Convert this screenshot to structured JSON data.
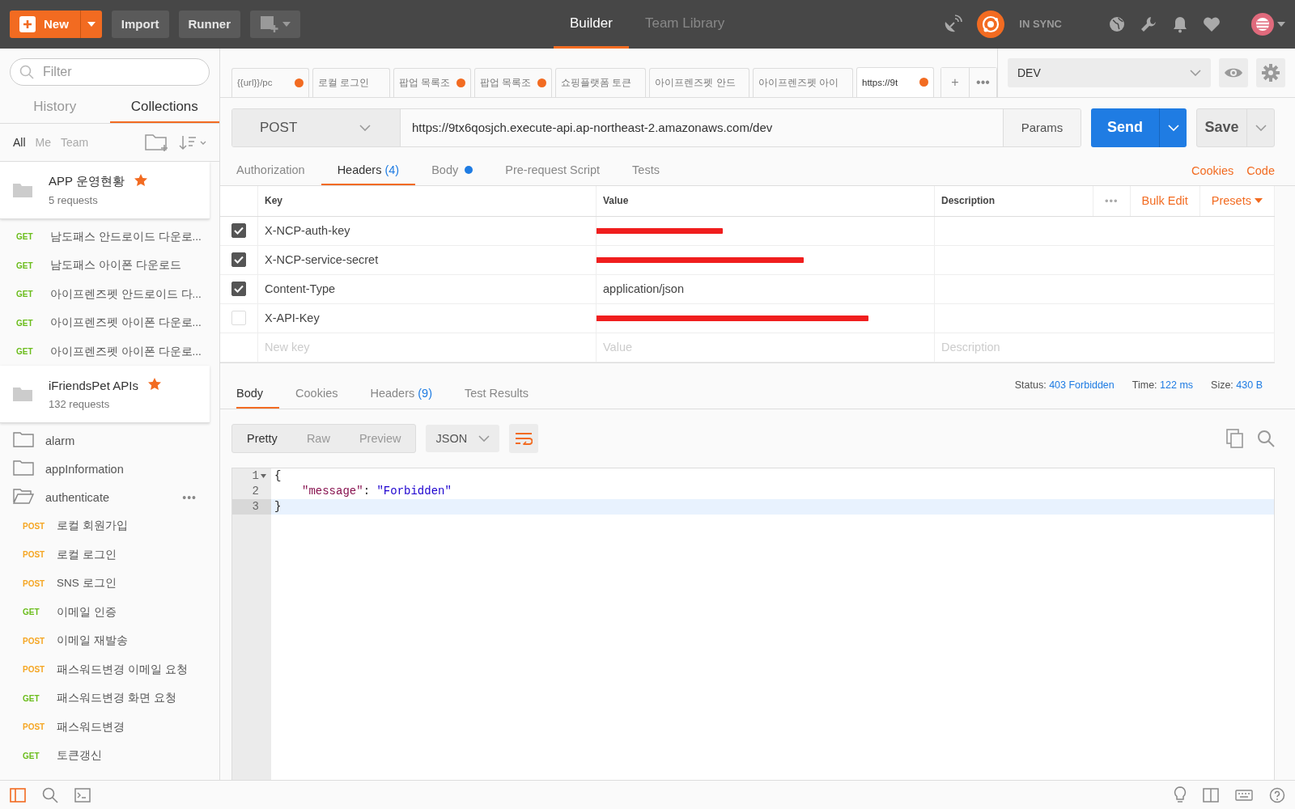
{
  "top_bar": {
    "new_button": "New",
    "buttons": [
      "Import",
      "Runner"
    ],
    "nav_tabs": [
      {
        "label": "Builder",
        "selected": true
      },
      {
        "label": "Team Library",
        "selected": false
      }
    ],
    "sync_status": "IN SYNC"
  },
  "sidebar": {
    "filter_placeholder": "Filter",
    "tabs": [
      {
        "label": "History",
        "selected": false
      },
      {
        "label": "Collections",
        "selected": true
      }
    ],
    "scopes": [
      {
        "label": "All",
        "selected": true
      },
      {
        "label": "Me",
        "selected": false
      },
      {
        "label": "Team",
        "selected": false
      }
    ],
    "items": [
      {
        "kind": "collection",
        "name": "APP 운영현황",
        "count": "5 requests",
        "starred": true
      },
      {
        "kind": "request",
        "method": "GET",
        "name": "남도패스 안드로이드 다운로..."
      },
      {
        "kind": "request",
        "method": "GET",
        "name": "남도패스 아이폰 다운로드"
      },
      {
        "kind": "request",
        "method": "GET",
        "name": "아이프렌즈펫 안드로이드 다..."
      },
      {
        "kind": "request",
        "method": "GET",
        "name": "아이프렌즈펫 아이폰 다운로..."
      },
      {
        "kind": "request",
        "method": "GET",
        "name": "아이프렌즈펫 아이폰 다운로..."
      },
      {
        "kind": "collection",
        "name": "iFriendsPet APIs",
        "count": "132 requests",
        "starred": true
      },
      {
        "kind": "folder",
        "name": "alarm",
        "expanded": false
      },
      {
        "kind": "folder",
        "name": "appInformation",
        "expanded": false
      },
      {
        "kind": "folder",
        "name": "authenticate",
        "expanded": true,
        "more": "•••"
      },
      {
        "kind": "request",
        "method": "POST",
        "name": "로컬 회원가입"
      },
      {
        "kind": "request",
        "method": "POST",
        "name": "로컬 로그인"
      },
      {
        "kind": "request",
        "method": "POST",
        "name": "SNS 로그인"
      },
      {
        "kind": "request",
        "method": "GET",
        "name": "이메일 인증"
      },
      {
        "kind": "request",
        "method": "POST",
        "name": "이메일 재발송"
      },
      {
        "kind": "request",
        "method": "POST",
        "name": "패스워드변경 이메일 요청"
      },
      {
        "kind": "request",
        "method": "GET",
        "name": "패스워드변경 화면 요청"
      },
      {
        "kind": "request",
        "method": "POST",
        "name": "패스워드변경"
      },
      {
        "kind": "request",
        "method": "GET",
        "name": "토큰갱신"
      }
    ]
  },
  "request_tabs": [
    {
      "label": "{{url}}/pc",
      "unsaved": true,
      "selected": false
    },
    {
      "label": "로컬 로그인",
      "unsaved": false,
      "selected": false
    },
    {
      "label": "팝업 목록조",
      "unsaved": true,
      "selected": false
    },
    {
      "label": "팝업 목록조",
      "unsaved": true,
      "selected": false
    },
    {
      "label": "쇼핑플랫폼 토큰",
      "unsaved": false,
      "selected": false
    },
    {
      "label": "아이프렌즈펫 안드",
      "unsaved": false,
      "selected": false
    },
    {
      "label": "아이프렌즈펫 아이",
      "unsaved": false,
      "selected": false
    },
    {
      "label": "https://9t",
      "unsaved": true,
      "selected": true
    }
  ],
  "tab_actions": {
    "add": "+",
    "more": "•••"
  },
  "environment": {
    "value": "DEV"
  },
  "request": {
    "method": "POST",
    "url": "https://9tx6qosjch.execute-api.ap-northeast-2.amazonaws.com/dev",
    "params": "Params",
    "send": "Send",
    "save": "Save"
  },
  "request_sections": [
    {
      "label": "Authorization",
      "dot": false,
      "selected": false
    },
    {
      "label": "Headers",
      "badge": "(4)",
      "dot": false,
      "selected": true
    },
    {
      "label": "Body",
      "dot": true,
      "selected": false
    },
    {
      "label": "Pre-request Script",
      "dot": false,
      "selected": false
    },
    {
      "label": "Tests",
      "dot": false,
      "selected": false
    }
  ],
  "request_links": [
    "Cookies",
    "Code"
  ],
  "headers_table": {
    "columns": [
      "Key",
      "Value",
      "Description"
    ],
    "more": "•••",
    "bulk_edit": "Bulk Edit",
    "presets": "Presets",
    "rows": [
      {
        "checked": true,
        "key": "X-NCP-auth-key",
        "redacted": true
      },
      {
        "checked": true,
        "key": "X-NCP-service-secret",
        "redacted": true
      },
      {
        "checked": true,
        "key": "Content-Type",
        "redacted": false,
        "value": "application/json"
      },
      {
        "checked": false,
        "key": "X-API-Key",
        "redacted": true
      }
    ],
    "new_row": {
      "key_placeholder": "New key",
      "value_placeholder": "Value",
      "description_placeholder": "Description"
    }
  },
  "response": {
    "tabs": [
      {
        "label": "Body",
        "selected": true
      },
      {
        "label": "Cookies",
        "selected": false
      },
      {
        "label": "Headers",
        "badge": "(9)",
        "selected": false
      },
      {
        "label": "Test Results",
        "selected": false
      }
    ],
    "status": [
      {
        "label": "Status:",
        "value": "403 Forbidden"
      },
      {
        "label": "Time:",
        "value": "122 ms"
      },
      {
        "label": "Size:",
        "value": "430 B"
      }
    ],
    "views": [
      {
        "label": "Pretty",
        "selected": true
      },
      {
        "label": "Raw",
        "selected": false
      },
      {
        "label": "Preview",
        "selected": false
      }
    ],
    "format": "JSON",
    "lines": [
      {
        "number": "1",
        "foldable": true,
        "selected": false,
        "indented": false,
        "tokens": [
          {
            "kind": "brace",
            "text": "{"
          }
        ]
      },
      {
        "number": "2",
        "foldable": false,
        "selected": false,
        "indented": true,
        "tokens": [
          {
            "kind": "key",
            "text": "\"message\""
          },
          {
            "kind": "punct",
            "text": ": "
          },
          {
            "kind": "string",
            "text": "\"Forbidden\""
          }
        ]
      },
      {
        "number": "3",
        "foldable": false,
        "selected": true,
        "indented": false,
        "tokens": [
          {
            "kind": "brace",
            "text": "}"
          }
        ]
      }
    ]
  }
}
